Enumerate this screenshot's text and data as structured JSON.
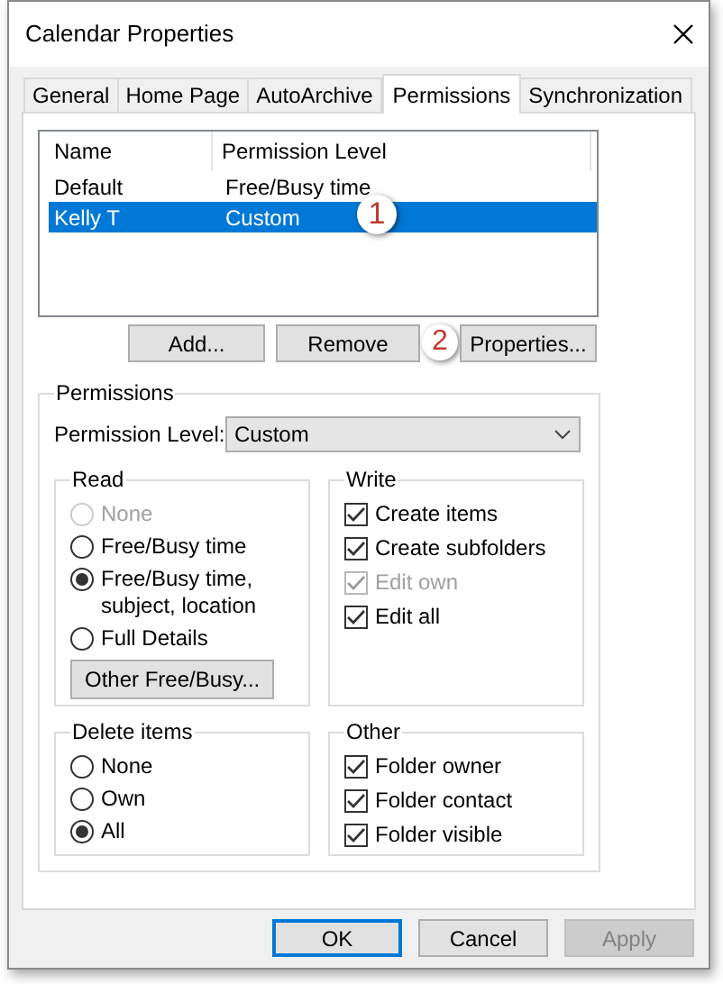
{
  "window": {
    "title": "Calendar Properties"
  },
  "tabs": [
    {
      "label": "General",
      "selected": false
    },
    {
      "label": "Home Page",
      "selected": false
    },
    {
      "label": "AutoArchive",
      "selected": false
    },
    {
      "label": "Permissions",
      "selected": true
    },
    {
      "label": "Synchronization",
      "selected": false
    }
  ],
  "permission_list": {
    "columns": [
      "Name",
      "Permission Level"
    ],
    "rows": [
      {
        "name": "Default",
        "level": "Free/Busy time",
        "selected": false
      },
      {
        "name": "Kelly T",
        "level": "Custom",
        "selected": true,
        "callout": "1"
      }
    ]
  },
  "list_buttons": [
    {
      "label": "Add..."
    },
    {
      "label": "Remove",
      "callout": "2"
    },
    {
      "label": "Properties..."
    }
  ],
  "permissions": {
    "title": "Permissions",
    "level_label": "Permission Level:",
    "level_value": "Custom",
    "read": {
      "title": "Read",
      "options": [
        {
          "label": "None",
          "selected": false,
          "disabled": true
        },
        {
          "label": "Free/Busy time",
          "selected": false,
          "disabled": false
        },
        {
          "label": "Free/Busy time, subject, location",
          "selected": true,
          "disabled": false
        },
        {
          "label": "Full Details",
          "selected": false,
          "disabled": false
        }
      ],
      "button": "Other Free/Busy..."
    },
    "write": {
      "title": "Write",
      "items": [
        {
          "label": "Create items",
          "checked": true,
          "disabled": false
        },
        {
          "label": "Create subfolders",
          "checked": true,
          "disabled": false
        },
        {
          "label": "Edit own",
          "checked": true,
          "disabled": true
        },
        {
          "label": "Edit all",
          "checked": true,
          "disabled": false
        }
      ]
    },
    "delete_items": {
      "title": "Delete items",
      "options": [
        {
          "label": "None",
          "selected": false,
          "disabled": false
        },
        {
          "label": "Own",
          "selected": false,
          "disabled": false
        },
        {
          "label": "All",
          "selected": true,
          "disabled": false
        }
      ]
    },
    "other": {
      "title": "Other",
      "items": [
        {
          "label": "Folder owner",
          "checked": true,
          "disabled": false
        },
        {
          "label": "Folder contact",
          "checked": true,
          "disabled": false
        },
        {
          "label": "Folder visible",
          "checked": true,
          "disabled": false
        }
      ]
    }
  },
  "footer_buttons": [
    {
      "label": "OK",
      "kind": "default"
    },
    {
      "label": "Cancel",
      "kind": "normal"
    },
    {
      "label": "Apply",
      "kind": "disabled"
    }
  ]
}
